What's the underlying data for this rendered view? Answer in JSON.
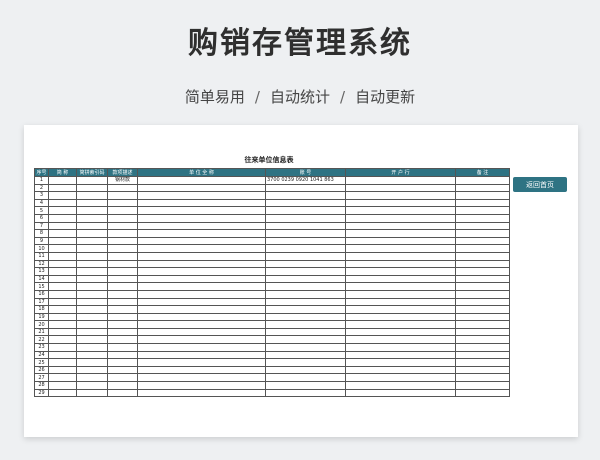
{
  "header": {
    "title": "购销存管理系统",
    "features": [
      "简单易用",
      "自动统计",
      "自动更新"
    ],
    "separator": "/"
  },
  "sheet": {
    "title": "往来单位信息表",
    "columns": [
      "序号",
      "简 称",
      "简拼索引码",
      "款项描述",
      "单 位 全 称",
      "账 号",
      "开 户 行",
      "备 注"
    ],
    "rows": [
      [
        "1",
        "",
        "",
        "钢材款",
        "",
        "3700 0239 0920 1041 863",
        "",
        ""
      ]
    ],
    "row_count": 29,
    "back_button_label": "返回首页"
  }
}
